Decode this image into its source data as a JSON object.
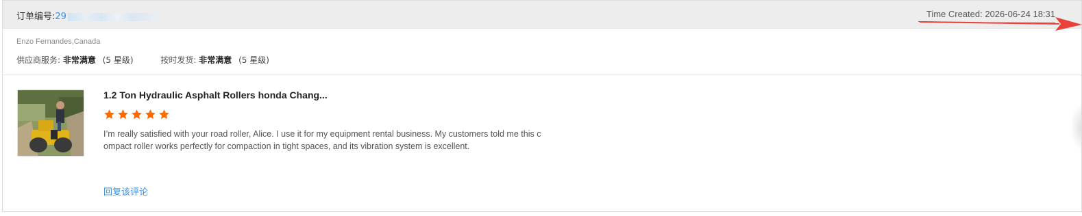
{
  "order": {
    "label": "订单编号:",
    "number_visible": "29"
  },
  "time_created": "Time Created: 2026-06-24 18:31",
  "buyer": {
    "name_location": "Enzo Fernandes,Canada"
  },
  "ratings": [
    {
      "label": "供应商服务:",
      "value": "非常满意",
      "level": "(5 星级)"
    },
    {
      "label": "按时发货:",
      "value": "非常满意",
      "level": "(5 星级)"
    }
  ],
  "review": {
    "product_title": "1.2 Ton Hydraulic Asphalt Rollers honda Chang...",
    "rating_stars": 5,
    "star_color": "#ff6a00",
    "text": "I’m really satisfied with your road roller, Alice. I use it for my equipment rental business. My customers told me this compact roller works perfectly for compaction in tight spaces, and its vibration system is excellent.",
    "reply_link": "回复该评论"
  },
  "colors": {
    "link": "#3a8ee6",
    "header_bg": "#ededed",
    "annotation_arrow": "#e8423a"
  }
}
